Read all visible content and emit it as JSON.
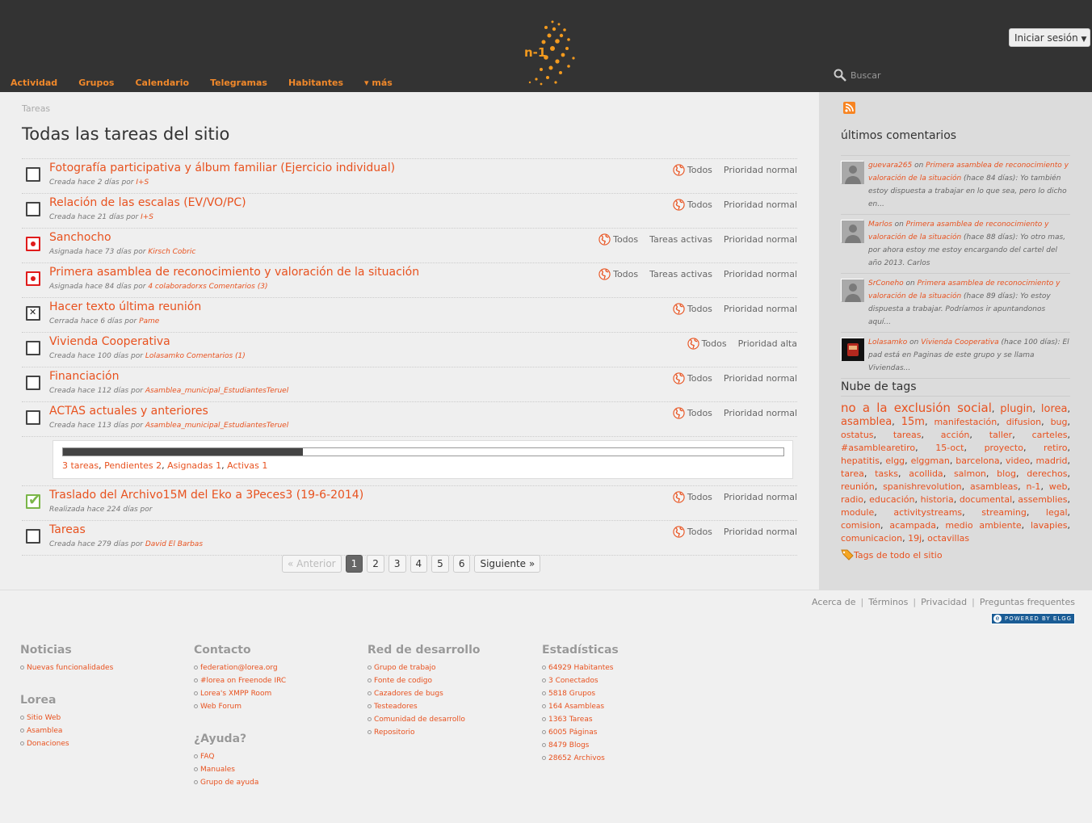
{
  "header": {
    "logo_text": "n-1",
    "login_label": "Iniciar sesión",
    "search_placeholder": "Buscar",
    "nav": [
      {
        "label": "Actividad"
      },
      {
        "label": "Grupos"
      },
      {
        "label": "Calendario"
      },
      {
        "label": "Telegramas"
      },
      {
        "label": "Habitantes"
      },
      {
        "label": "▾ más"
      }
    ]
  },
  "main": {
    "breadcrumb": "Tareas",
    "title": "Todas las tareas del sitio",
    "tasks": [
      {
        "status": "new",
        "title": "Fotografía participativa y álbum familiar (Ejercicio individual)",
        "meta_prefix": "Creada hace 2 días por",
        "meta_link": "I+S",
        "access": "Todos",
        "state_tag": "",
        "priority": "Prioridad normal"
      },
      {
        "status": "new",
        "title": "Relación de las escalas (EV/VO/PC)",
        "meta_prefix": "Creada hace 21 días por",
        "meta_link": "I+S",
        "access": "Todos",
        "state_tag": "",
        "priority": "Prioridad normal"
      },
      {
        "status": "active",
        "title": "Sanchocho",
        "meta_prefix": "Asignada hace 73 días por",
        "meta_link": "Kirsch Cobric",
        "access": "Todos",
        "state_tag": "Tareas activas",
        "priority": "Prioridad normal"
      },
      {
        "status": "active",
        "title": "Primera asamblea de reconocimiento y valoración de la situación",
        "meta_prefix": "Asignada hace 84 días por",
        "meta_link": "4 colaboradorxs Comentarios (3)",
        "access": "Todos",
        "state_tag": "Tareas activas",
        "priority": "Prioridad normal"
      },
      {
        "status": "closed",
        "title": "Hacer texto última reunión",
        "meta_prefix": "Cerrada hace 6 días por",
        "meta_link": "Pame",
        "access": "Todos",
        "state_tag": "",
        "priority": "Prioridad normal"
      },
      {
        "status": "new",
        "title": "Vivienda Cooperativa",
        "meta_prefix": "Creada hace 100 días por",
        "meta_link": "Lolasamko Comentarios (1)",
        "access": "Todos",
        "state_tag": "",
        "priority": "Prioridad alta"
      },
      {
        "status": "new",
        "title": "Financiación",
        "meta_prefix": "Creada hace 112 días por",
        "meta_link": "Asamblea_municipal_EstudiantesTeruel",
        "access": "Todos",
        "state_tag": "",
        "priority": "Prioridad normal"
      },
      {
        "status": "new",
        "title": "ACTAS actuales y anteriores",
        "meta_prefix": "Creada hace 113 días por",
        "meta_link": "Asamblea_municipal_EstudiantesTeruel",
        "access": "Todos",
        "state_tag": "",
        "priority": "Prioridad normal"
      },
      {
        "status": "done",
        "title": "Traslado del Archivo15M del Eko a 3Peces3 (19-6-2014)",
        "meta_prefix": "Realizada hace 224 días por",
        "meta_link": "",
        "access": "Todos",
        "state_tag": "",
        "priority": "Prioridad normal"
      },
      {
        "status": "new",
        "title": "Tareas",
        "meta_prefix": "Creada hace 279 días por",
        "meta_link": "David El Barbas",
        "access": "Todos",
        "state_tag": "",
        "priority": "Prioridad normal"
      }
    ],
    "progress": {
      "fraction": 0.333,
      "links": [
        "3 tareas",
        "Pendientes 2",
        "Asignadas 1",
        "Activas 1"
      ]
    },
    "pager": {
      "prev": "« Anterior",
      "pages": [
        "1",
        "2",
        "3",
        "4",
        "5",
        "6"
      ],
      "current": "1",
      "next": "Siguiente »"
    }
  },
  "sidebar": {
    "comments_title": "últimos comentarios",
    "comments": [
      {
        "user": "guevara265",
        "on": "on",
        "target": "Primera asamblea de reconocimiento y valoración de la situación",
        "text": "(hace 84 días): Yo también estoy dispuesta a trabajar en lo que sea, pero lo dicho en..."
      },
      {
        "user": "Marlos",
        "on": "on",
        "target": "Primera asamblea de reconocimiento y valoración de la situación",
        "text": "(hace 88 días): Yo otro mas, por ahora estoy me estoy encargando del cartel del año 2013. Carlos"
      },
      {
        "user": "SrConeho",
        "on": "on",
        "target": "Primera asamblea de reconocimiento y valoración de la situación",
        "text": "(hace 89 días): Yo estoy dispuesta a trabajar. Podríamos ir apuntandonos aquí..."
      },
      {
        "user": "Lolasamko",
        "on": "on",
        "target": "Vivienda Cooperativa",
        "text": "(hace 100 días): El pad está en Paginas de este grupo y se llama Viviendas..."
      }
    ],
    "tags_title": "Nube de tags",
    "tags": [
      "no a la exclusión social",
      "plugin",
      "lorea",
      "asamblea",
      "15m",
      "manifestación",
      "difusion",
      "bug",
      "ostatus",
      "tareas",
      "acción",
      "taller",
      "carteles",
      "#asamblearetiro",
      "15-oct",
      "proyecto",
      "retiro",
      "hepatitis",
      "elgg",
      "elggman",
      "barcelona",
      "video",
      "madrid",
      "tarea",
      "tasks",
      "acollida",
      "salmon",
      "blog",
      "derechos",
      "reunión",
      "spanishrevolution",
      "asambleas",
      "n-1",
      "web",
      "radio",
      "educación",
      "historia",
      "documental",
      "assemblies",
      "module",
      "activitystreams",
      "streaming",
      "legal",
      "comision",
      "acampada",
      "medio ambiente",
      "lavapies",
      "comunicacion",
      "19j",
      "octavillas"
    ],
    "all_tags_label": "Tags de todo el sitio"
  },
  "footer": {
    "links": [
      "Acerca de",
      "Términos",
      "Privacidad",
      "Preguntas frequentes"
    ],
    "powered": "POWERED BY ELGG",
    "columns": [
      {
        "sections": [
          {
            "title": "Noticias",
            "items": [
              "Nuevas funcionalidades"
            ]
          },
          {
            "title": "Lorea",
            "items": [
              "Sitio Web",
              "Asamblea",
              "Donaciones"
            ]
          }
        ]
      },
      {
        "sections": [
          {
            "title": "Contacto",
            "items": [
              "federation@lorea.org",
              "#lorea on Freenode IRC",
              "Lorea's XMPP Room",
              "Web Forum"
            ]
          },
          {
            "title": "¿Ayuda?",
            "items": [
              "FAQ",
              "Manuales",
              "Grupo de ayuda"
            ]
          }
        ]
      },
      {
        "sections": [
          {
            "title": "Red de desarrollo",
            "items": [
              "Grupo de trabajo",
              "Fonte de codigo",
              "Cazadores de bugs",
              "Testeadores",
              "Comunidad de desarrollo",
              "Repositorio"
            ]
          }
        ]
      },
      {
        "sections": [
          {
            "title": "Estadísticas",
            "items": [
              "64929 Habitantes",
              "3 Conectados",
              "5818 Grupos",
              "164 Asambleas",
              "1363 Tareas",
              "6005 Páginas",
              "8479 Blogs",
              "28652 Archivos"
            ]
          }
        ]
      }
    ]
  },
  "colors": {
    "accent": "#e8521f",
    "header_bg": "#333333",
    "nav": "#f0882a"
  },
  "icons": [
    "logo-icon",
    "search-icon",
    "rss-icon",
    "globe-icon",
    "tag-icon",
    "avatar",
    "elgg-logo-icon"
  ]
}
